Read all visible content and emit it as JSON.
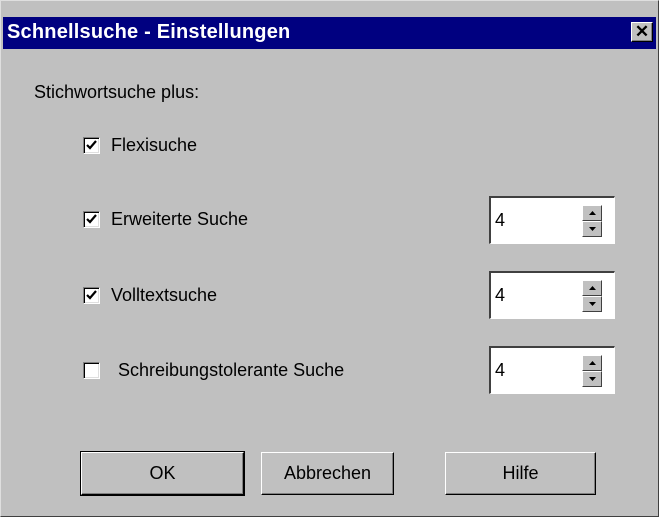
{
  "window": {
    "title": "Schnellsuche - Einstellungen"
  },
  "section_label": "Stichwortsuche plus:",
  "options": [
    {
      "label": "Flexisuche",
      "checked": true
    },
    {
      "label": "Erweiterte Suche",
      "checked": true,
      "value": "4"
    },
    {
      "label": "Volltextsuche",
      "checked": true,
      "value": "4"
    },
    {
      "label": "Schreibungstolerante Suche",
      "checked": false,
      "value": "4"
    }
  ],
  "buttons": {
    "ok": "OK",
    "cancel": "Abbrechen",
    "help": "Hilfe"
  },
  "icons": {
    "close": "close-icon",
    "checkmark": "checkmark-icon",
    "spin_up": "arrow-up-icon",
    "spin_down": "arrow-down-icon"
  }
}
